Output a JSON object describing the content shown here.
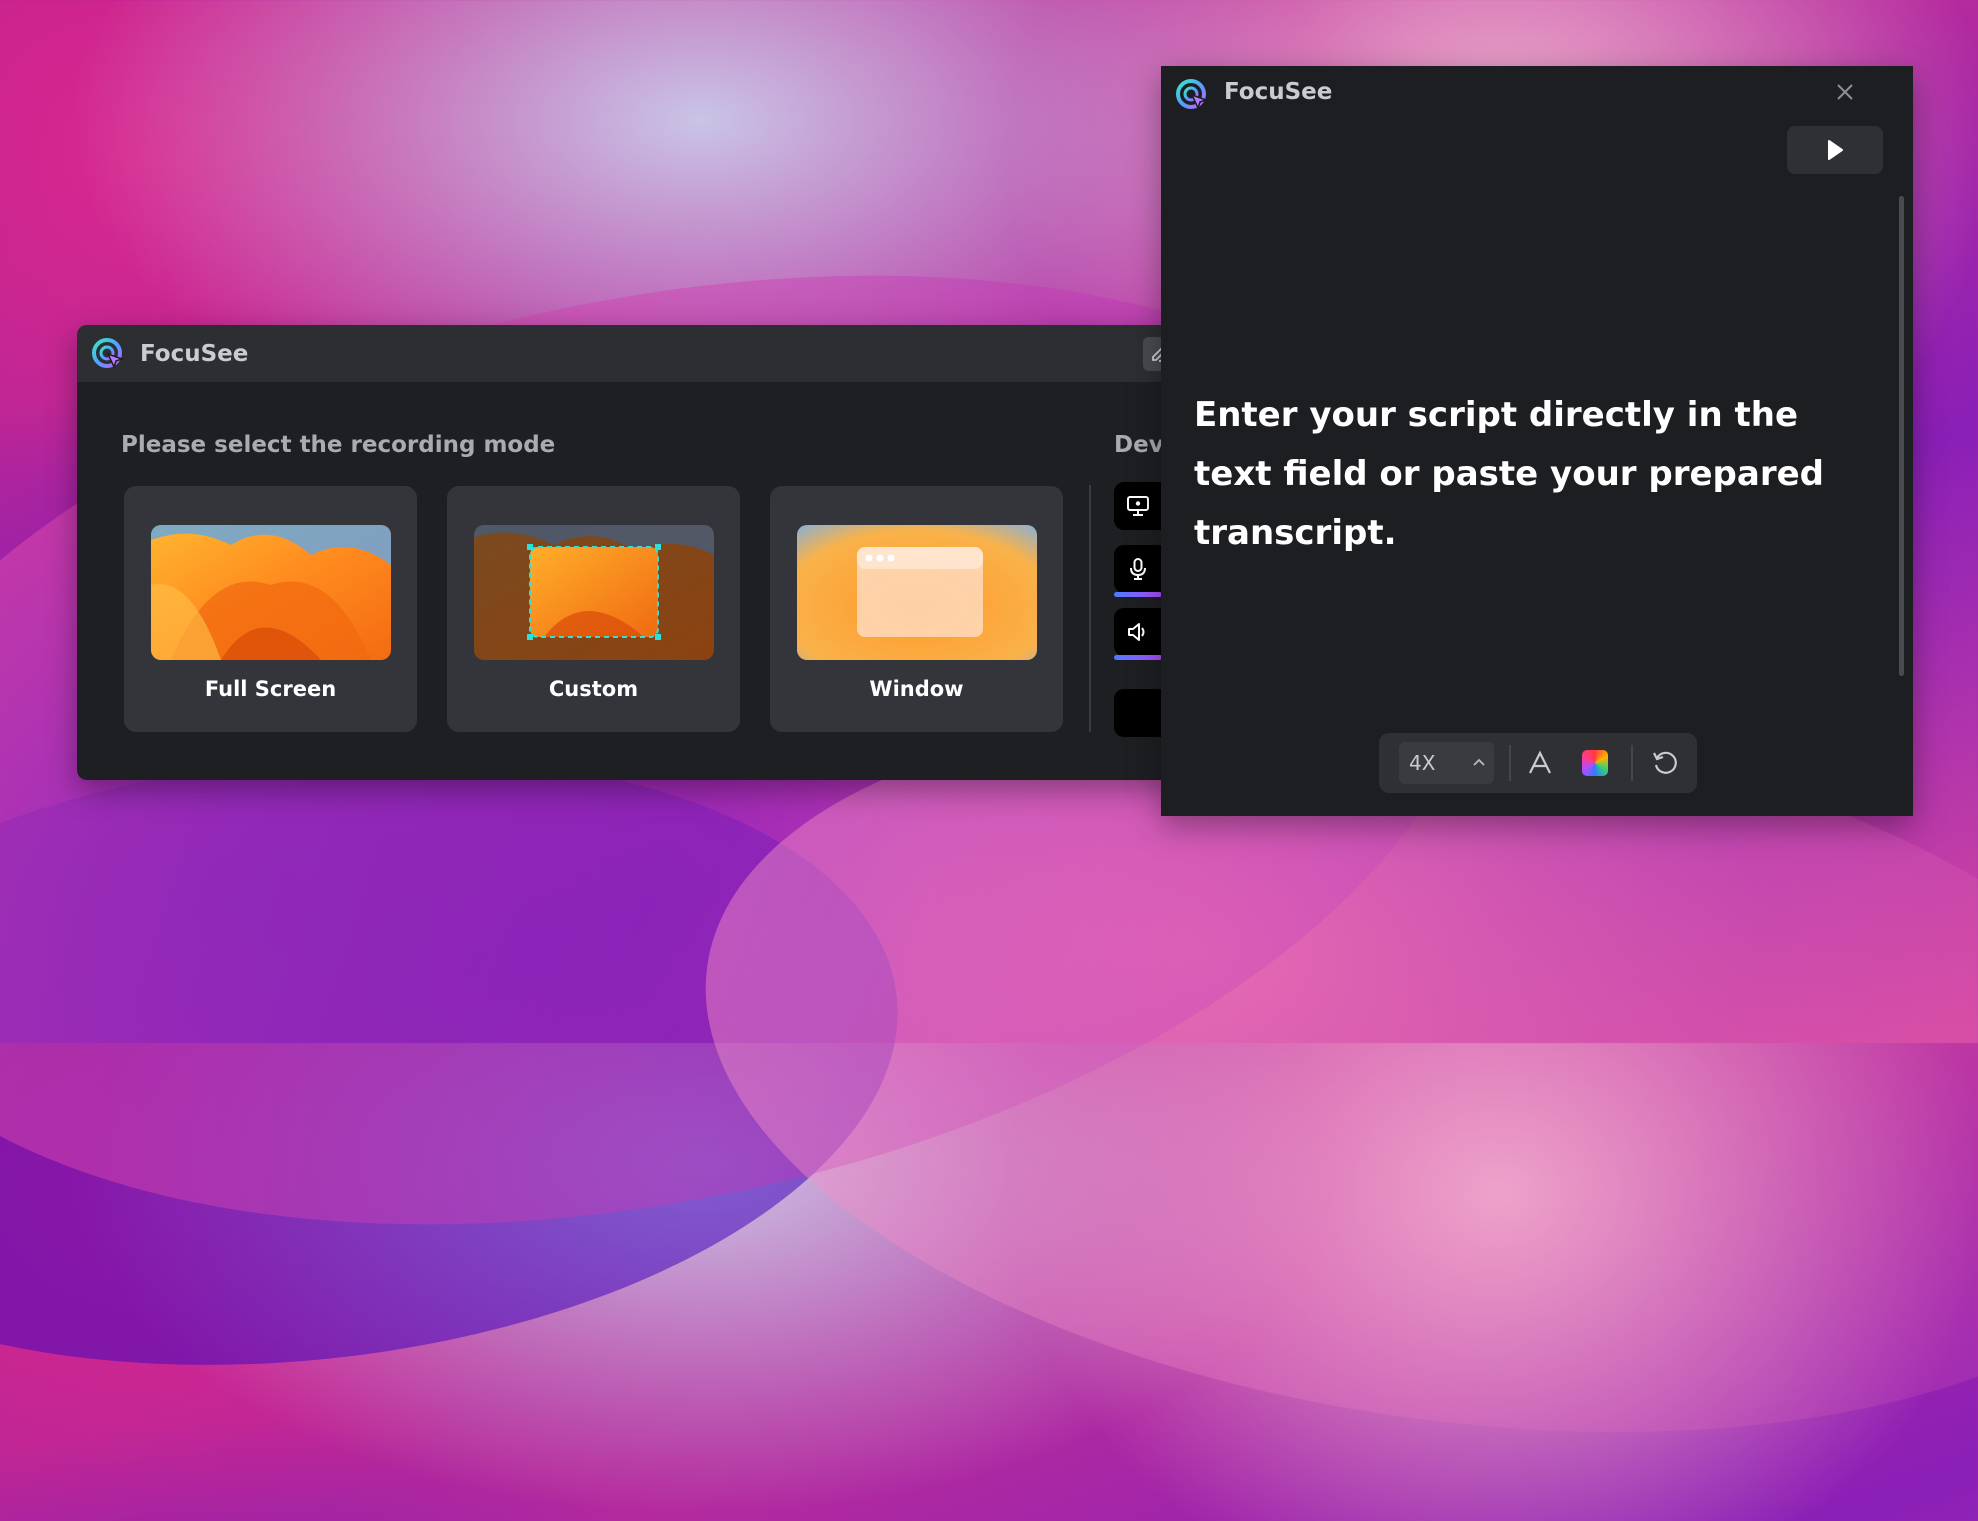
{
  "main_window": {
    "title": "FocuSee",
    "section_label": "Please select the recording mode",
    "devices_label": "Dev",
    "modes": [
      {
        "label": "Full Screen",
        "icon": "full-screen-thumbnail"
      },
      {
        "label": "Custom",
        "icon": "custom-region-thumbnail"
      },
      {
        "label": "Window",
        "icon": "window-thumbnail"
      }
    ],
    "device_buttons": [
      {
        "icon": "screen-icon"
      },
      {
        "icon": "microphone-icon"
      },
      {
        "icon": "speaker-icon"
      },
      {
        "icon": "camera-icon"
      }
    ]
  },
  "prompter_window": {
    "title": "FocuSee",
    "script_text": "Enter your script directly in the text field or paste your prepared transcript.",
    "toolbar": {
      "speed": "4X",
      "icons": [
        "chevron-up-icon",
        "font-icon",
        "color-picker-icon",
        "reset-icon"
      ]
    }
  },
  "colors": {
    "accent_orange": "#f7931e",
    "panel_dark": "#1e1f23",
    "card_bg": "#33353b",
    "level_meter": "#7a5cff"
  }
}
